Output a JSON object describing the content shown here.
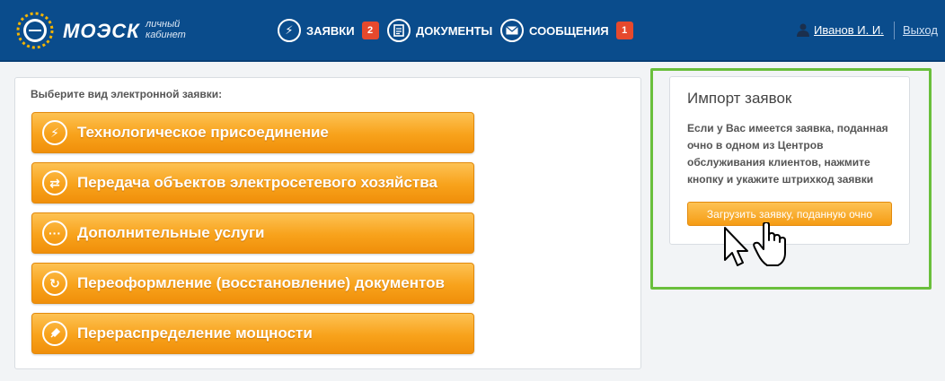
{
  "header": {
    "brand": "МОЭСК",
    "brand_sub_line1": "личный",
    "brand_sub_line2": "кабинет",
    "nav": [
      {
        "label": "ЗАЯВКИ",
        "badge": "2",
        "icon": "lightning-icon"
      },
      {
        "label": "ДОКУМЕНТЫ",
        "icon": "document-icon"
      },
      {
        "label": "СООБЩЕНИЯ",
        "badge": "1",
        "icon": "envelope-icon"
      }
    ],
    "user_name": "Иванов И. И.",
    "logout": "Выход"
  },
  "main": {
    "title": "Выберите вид электронной заявки:",
    "buttons": [
      {
        "label": "Технологическое присоединение",
        "icon": "lightning-icon"
      },
      {
        "label": "Передача объектов электросетевого хозяйства",
        "icon": "transfer-icon"
      },
      {
        "label": "Дополнительные услуги",
        "icon": "ellipsis-icon"
      },
      {
        "label": "Переоформление (восстановление) документов",
        "icon": "refresh-icon"
      },
      {
        "label": "Перераспределение мощности",
        "icon": "plug-icon"
      }
    ]
  },
  "import": {
    "title": "Импорт заявок",
    "text": "Если у Вас имеется заявка, поданная очно в одном из Центров обслуживания клиентов, нажмите кнопку и укажите штрихкод заявки",
    "button": "Загрузить заявку, поданную очно"
  },
  "colors": {
    "header_bg": "#0a4c8c",
    "accent_orange": "#f8a21b",
    "badge_red": "#e6492d",
    "highlight_green": "#6abf3c"
  }
}
